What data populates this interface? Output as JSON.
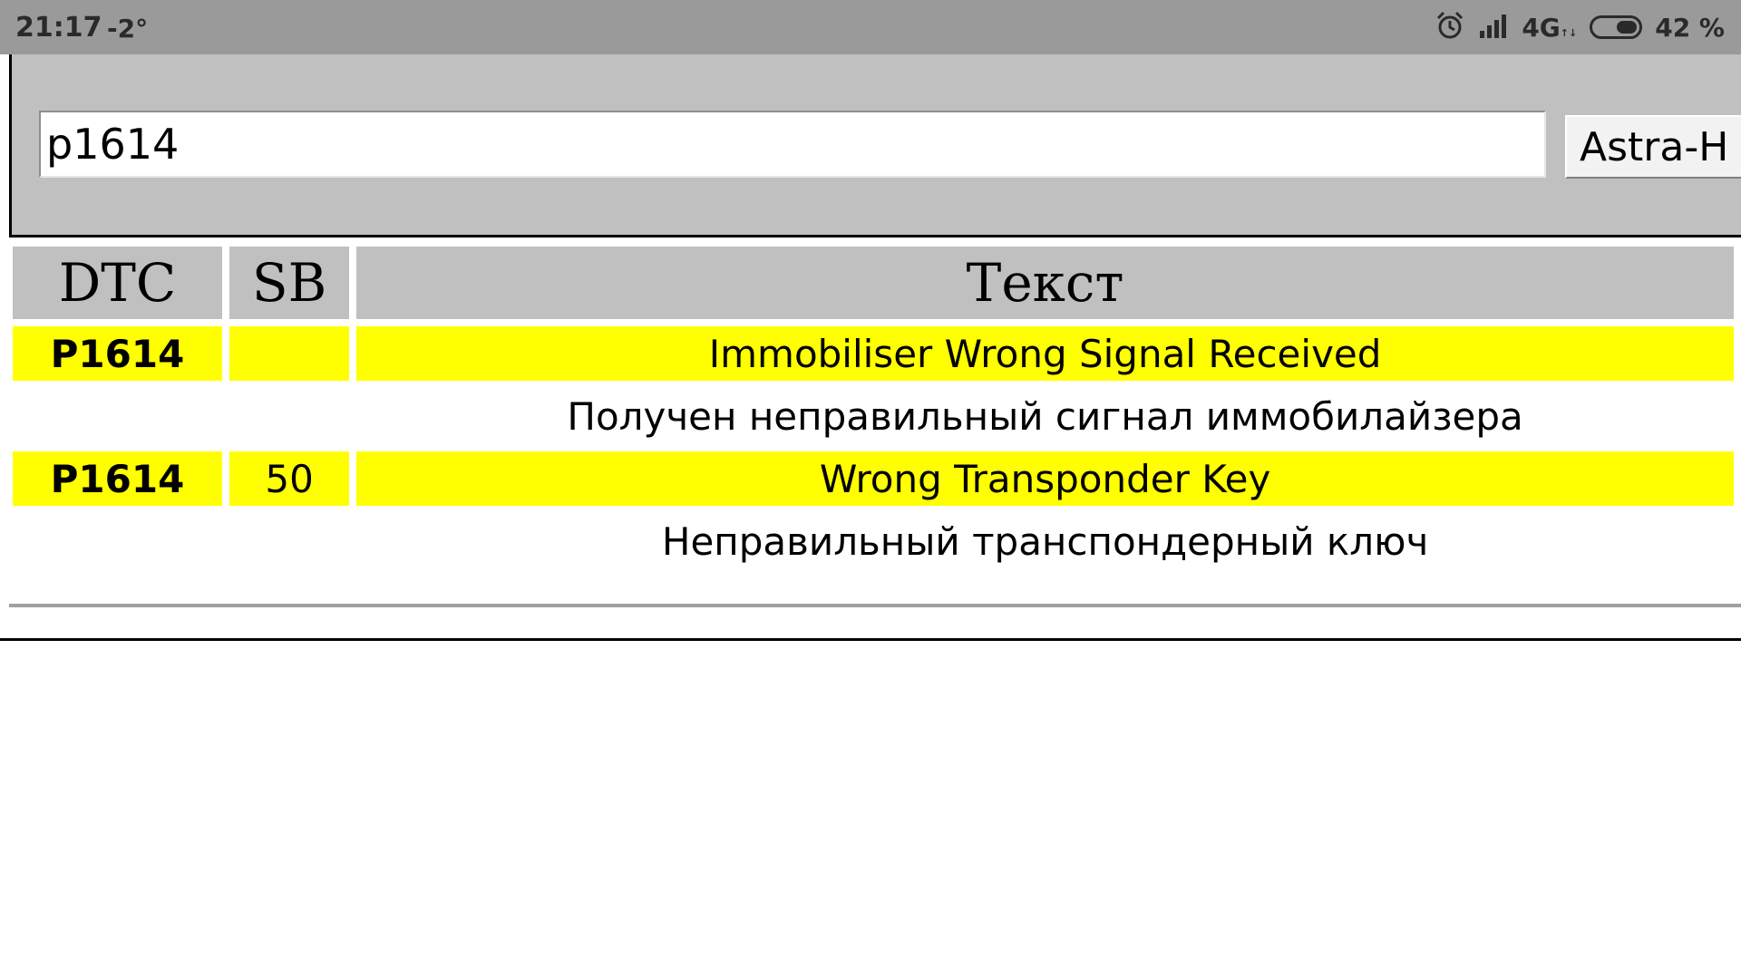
{
  "status_bar": {
    "time": "21:17",
    "temperature": "-2°",
    "network": "4G",
    "network_sub": "↑↓",
    "battery_percent": "42 %",
    "battery_level": 0.42
  },
  "search": {
    "query": "p1614",
    "model_button": "Astra-H"
  },
  "table": {
    "headers": {
      "dtc": "DTC",
      "sb": "SB",
      "text": "Текст"
    },
    "rows": [
      {
        "dtc": "P1614",
        "sb": "",
        "text_en": "Immobiliser Wrong Signal Received",
        "text_ru": "Получен неправильный сигнал иммобилайзера"
      },
      {
        "dtc": "P1614",
        "sb": "50",
        "text_en": "Wrong Transponder Key",
        "text_ru": "Неправильный транспондерный ключ"
      }
    ]
  },
  "colors": {
    "highlight": "#ffff00",
    "header_bg": "#c0c0c0",
    "status_bar": "#9a9a9a"
  }
}
